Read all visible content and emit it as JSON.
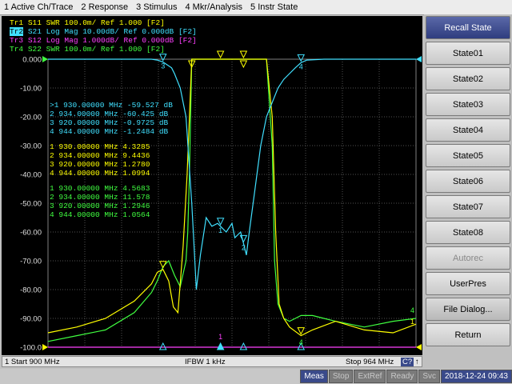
{
  "menu": [
    "1 Active Ch/Trace",
    "2 Response",
    "3 Stimulus",
    "4 Mkr/Analysis",
    "5 Instr State"
  ],
  "colors": {
    "tr1": "#ffff00",
    "tr2": "#40e0ff",
    "tr3": "#ff40ff",
    "tr4": "#40ff40",
    "grid": "#808080"
  },
  "traces": [
    {
      "id": "Tr1",
      "param": "S11",
      "text": "SWR 100.0m/ Ref 1.000 [F2]"
    },
    {
      "id": "Tr2",
      "param": "S21",
      "text": "Log Mag 10.00dB/ Ref 0.000dB [F2]"
    },
    {
      "id": "Tr3",
      "param": "S12",
      "text": "Log Mag 1.000dB/ Ref 0.000dB [F2]"
    },
    {
      "id": "Tr4",
      "param": "S22",
      "text": "SWR 100.0m/ Ref 1.000 [F2]"
    }
  ],
  "y_labels": [
    "0.000",
    "-10.00",
    "-20.00",
    "-30.00",
    "-40.00",
    "-50.00",
    "-60.00",
    "-70.00",
    "-80.00",
    "-90.00",
    "-100.0"
  ],
  "marker_tables": [
    {
      "color": "#40e0ff",
      "rows": [
        ">1  930.00000 MHz -59.527 dB",
        " 2  934.00000 MHz -60.425 dB",
        " 3  920.00000 MHz -0.9725 dB",
        " 4  944.00000 MHz -1.2484 dB"
      ]
    },
    {
      "color": "#ffff00",
      "rows": [
        " 1  930.00000 MHz  4.3285",
        " 2  934.00000 MHz  9.4436",
        " 3  920.00000 MHz  1.2780",
        " 4  944.00000 MHz  1.0994"
      ]
    },
    {
      "color": "#40ff40",
      "rows": [
        " 1  930.00000 MHz  4.5683",
        " 2  934.00000 MHz  11.578",
        " 3  920.00000 MHz  1.2946",
        " 4  944.00000 MHz  1.0564"
      ]
    }
  ],
  "marker_labels": {
    "top": [
      "1",
      "2",
      "3",
      "4"
    ],
    "bottom": [
      "1",
      "2",
      "3",
      "4"
    ]
  },
  "end_labels": [
    "4",
    "1"
  ],
  "status": {
    "start": "1  Start 900 MHz",
    "ifbw": "IFBW 1 kHz",
    "stop": "Stop 964 MHz",
    "cq": "C?",
    "arrow": "↑"
  },
  "bottom": {
    "meas": "Meas",
    "stop": "Stop",
    "extref": "ExtRef",
    "ready": "Ready",
    "svc": "Svc",
    "datetime": "2018-12-24 09:43"
  },
  "softkeys": [
    {
      "label": "Recall State",
      "style": "title"
    },
    {
      "label": "State01",
      "style": ""
    },
    {
      "label": "State02",
      "style": ""
    },
    {
      "label": "State03",
      "style": ""
    },
    {
      "label": "State04",
      "style": ""
    },
    {
      "label": "State05",
      "style": ""
    },
    {
      "label": "State06",
      "style": ""
    },
    {
      "label": "State07",
      "style": ""
    },
    {
      "label": "State08",
      "style": ""
    },
    {
      "label": "Autorec",
      "style": "dim"
    },
    {
      "label": "UserPres",
      "style": ""
    },
    {
      "label": "File Dialog...",
      "style": "sel"
    },
    {
      "label": "Return",
      "style": ""
    }
  ],
  "chart_data": {
    "type": "line",
    "xlim": [
      900,
      964
    ],
    "ylim": [
      -100,
      0
    ],
    "series": [
      {
        "name": "S21",
        "color": "#40e0ff",
        "x": [
          900,
          912,
          918,
          919,
          920,
          921.5,
          922,
          923,
          924,
          924.5,
          925,
          925.4,
          925.8,
          926.5,
          927.5,
          928.5,
          929.5,
          930,
          931,
          932,
          932.5,
          933.5,
          934,
          934.5,
          935,
          936,
          937,
          938,
          939,
          940,
          941,
          942,
          943,
          944,
          945,
          948,
          955,
          964
        ],
        "y": [
          0,
          0,
          0,
          -0.3,
          -1,
          -3,
          -5,
          -10,
          -20,
          -35,
          -50,
          -65,
          -80,
          -68,
          -55,
          -58,
          -57,
          -58,
          -60,
          -57,
          -62,
          -60,
          -64,
          -68,
          -60,
          -45,
          -30,
          -20,
          -15,
          -10,
          -7,
          -5,
          -3,
          -1.2,
          -0.3,
          0,
          0,
          0
        ]
      },
      {
        "name": "S11",
        "color": "#ffff00",
        "x": [
          900,
          905,
          910,
          915,
          918,
          919,
          920,
          921,
          921.8,
          922.6,
          923.5,
          924.2,
          924.6,
          925,
          929,
          935,
          938,
          939,
          939.6,
          940.2,
          941,
          942,
          944,
          946,
          950,
          955,
          960,
          964
        ],
        "y": [
          -95,
          -93,
          -90,
          -84,
          -78,
          -74,
          -73,
          -77,
          -86,
          -88,
          -65,
          -40,
          -20,
          0,
          0,
          0,
          0,
          -20,
          -60,
          -85,
          -90,
          -93,
          -96,
          -94,
          -91,
          -94,
          -95,
          -92
        ]
      },
      {
        "name": "S22",
        "color": "#40ff40",
        "x": [
          900,
          905,
          910,
          915,
          918,
          919,
          920,
          921,
          922,
          923,
          924,
          924.3,
          924.6,
          925,
          929,
          935,
          938,
          939,
          939.4,
          940,
          941,
          942,
          943,
          944,
          946,
          948,
          950,
          955,
          960,
          964
        ],
        "y": [
          -98,
          -96,
          -94,
          -88,
          -81,
          -77,
          -72,
          -70,
          -75,
          -79,
          -70,
          -60,
          -40,
          0,
          0,
          0,
          0,
          -30,
          -70,
          -85,
          -90,
          -91,
          -90,
          -89,
          -89,
          -90,
          -91,
          -93,
          -91,
          -90
        ]
      },
      {
        "name": "S12",
        "color": "#ff40ff",
        "x": [
          900,
          964
        ],
        "y": [
          -100,
          -100
        ]
      }
    ]
  }
}
